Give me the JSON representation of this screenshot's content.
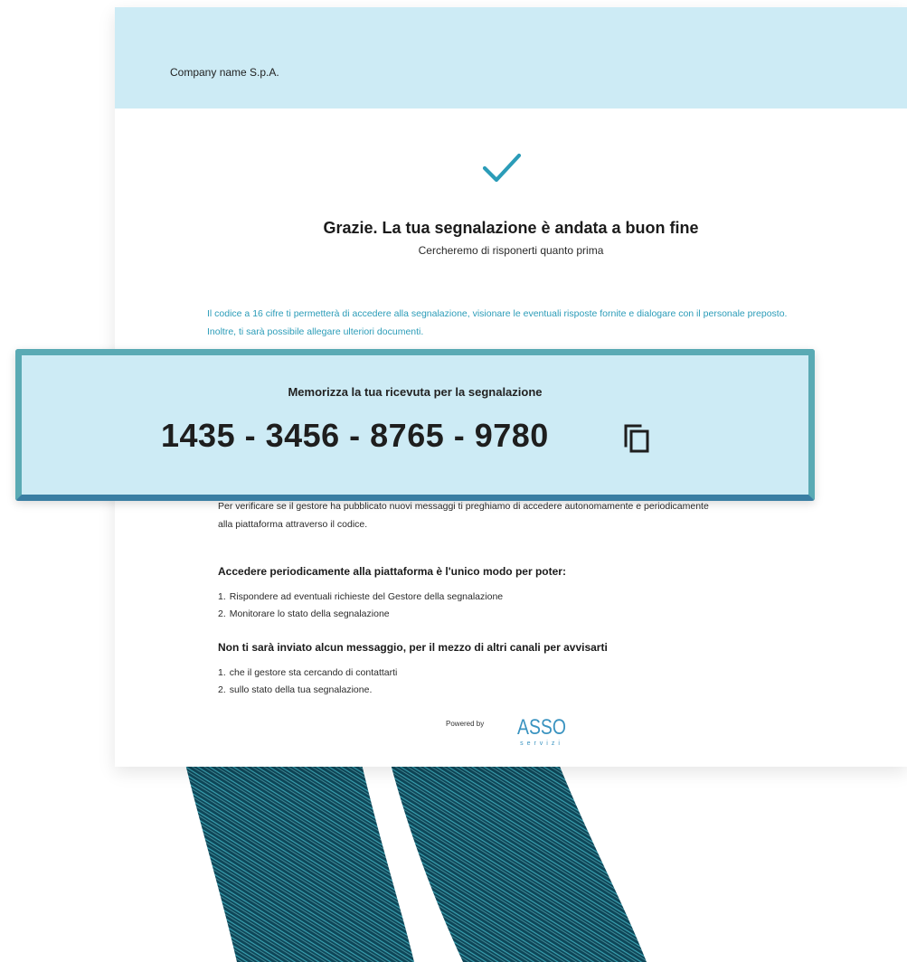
{
  "header": {
    "company_name": "Company name S.p.A."
  },
  "confirmation": {
    "icon": "checkmark-icon",
    "title": "Grazie. La tua segnalazione è andata a buon fine",
    "subtitle": "Cercheremo di risponerti quanto prima"
  },
  "info_text": "Il codice a 16 cifre ti permetterà di accedere alla segnalazione, visionare le eventuali risposte fornite e dialogare con il personale preposto. Inoltre, ti sarà possibile allegare ulteriori documenti.",
  "receipt": {
    "label": "Memorizza la tua ricevuta per la segnalazione",
    "code": "1435 - 3456 - 8765 - 9780",
    "copy_icon": "copy-icon"
  },
  "verify_text": {
    "line1": "Per verificare se il gestore ha pubblicato nuovi messaggi ti preghiamo di accedere autonomamente e periodicamente",
    "line2": "alla piattaforma attraverso il codice."
  },
  "section1": {
    "heading": "Accedere periodicamente alla piattaforma è l'unico modo per poter:",
    "items": [
      {
        "num": "1.",
        "text": "Rispondere ad eventuali richieste del Gestore della segnalazione"
      },
      {
        "num": "2.",
        "text": "Monitorare lo stato della segnalazione"
      }
    ]
  },
  "section2": {
    "heading": "Non ti sarà inviato alcun messaggio, per il mezzo di altri canali per avvisarti",
    "items": [
      {
        "num": "1.",
        "text": "che il gestore sta cercando di contattarti"
      },
      {
        "num": "2.",
        "text": "sullo stato della tua segnalazione."
      }
    ]
  },
  "footer": {
    "powered_by": "Powered by",
    "logo_text": "ASSO",
    "logo_subtext": "servizi"
  },
  "colors": {
    "header_bg": "#cdebf5",
    "accent": "#2b9cb8",
    "receipt_border": "#5aaab4"
  }
}
